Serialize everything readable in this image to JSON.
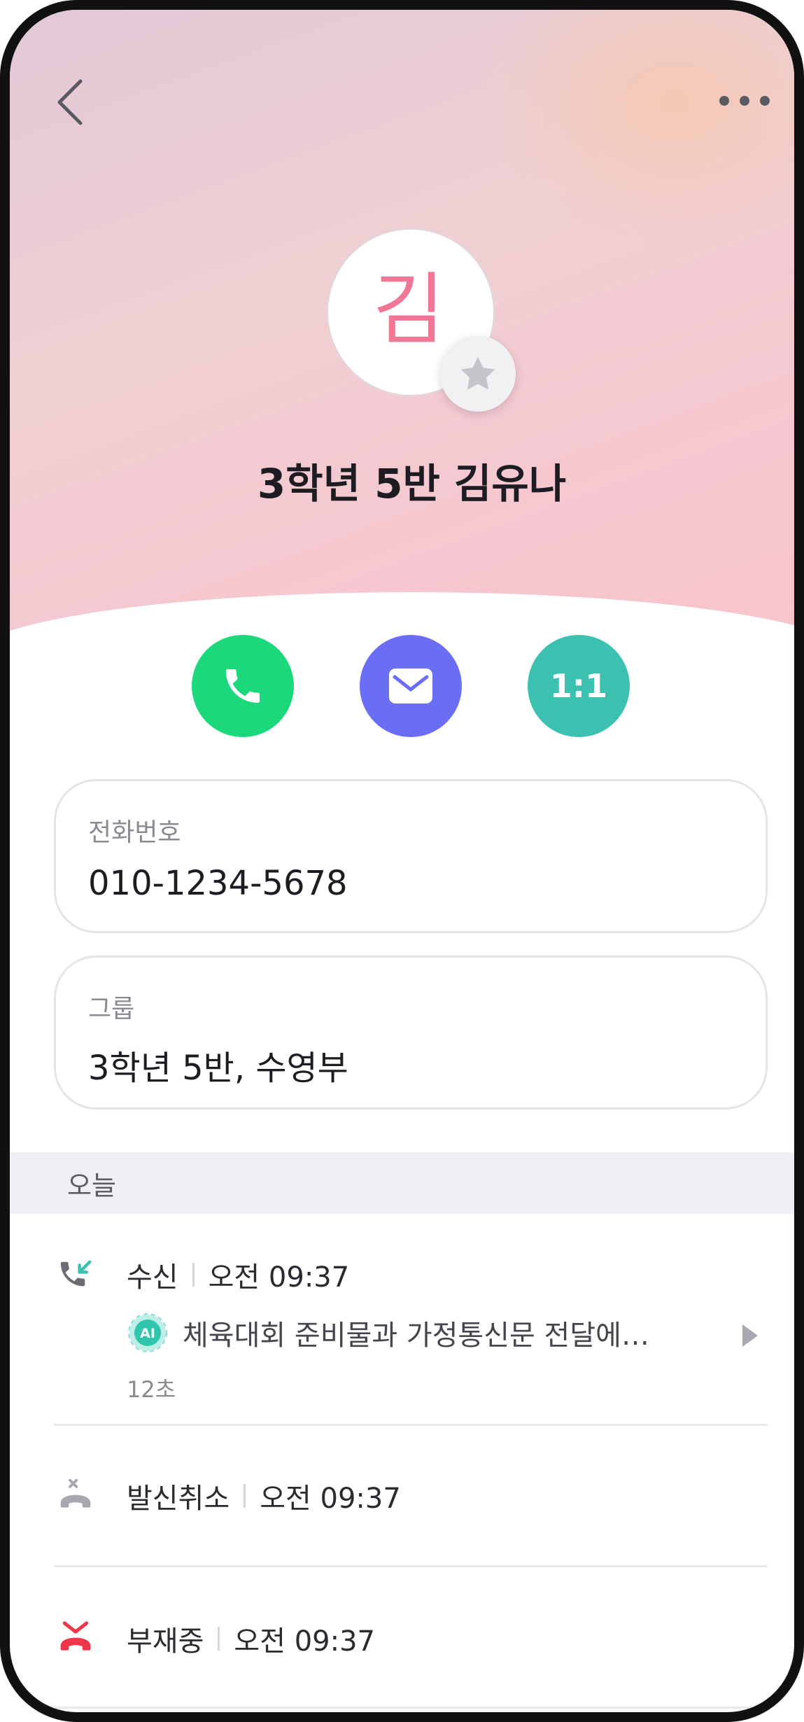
{
  "contact": {
    "initial": "김",
    "name": "3학년 5반 김유나"
  },
  "actions": {
    "chat_label": "1:1"
  },
  "phone": {
    "label": "전화번호",
    "value": "010-1234-5678"
  },
  "group": {
    "label": "그룹",
    "value": "3학년 5반, 수영부"
  },
  "history": {
    "section_title": "오늘",
    "items": [
      {
        "type": "수신",
        "time": "오전 09:37",
        "ai_label": "AI",
        "summary": "체육대회 준비물과 가정통신문 전달에…",
        "duration": "12초",
        "icon": "incoming-call-icon"
      },
      {
        "type": "발신취소",
        "time": "오전 09:37",
        "icon": "cancelled-call-icon"
      },
      {
        "type": "부재중",
        "time": "오전 09:37",
        "icon": "missed-call-icon"
      }
    ]
  },
  "colors": {
    "call": "#1bd87c",
    "mail": "#6a6ef5",
    "chat": "#3cc1b0",
    "missed": "#f0364a",
    "accent_initial": "#f07896"
  }
}
